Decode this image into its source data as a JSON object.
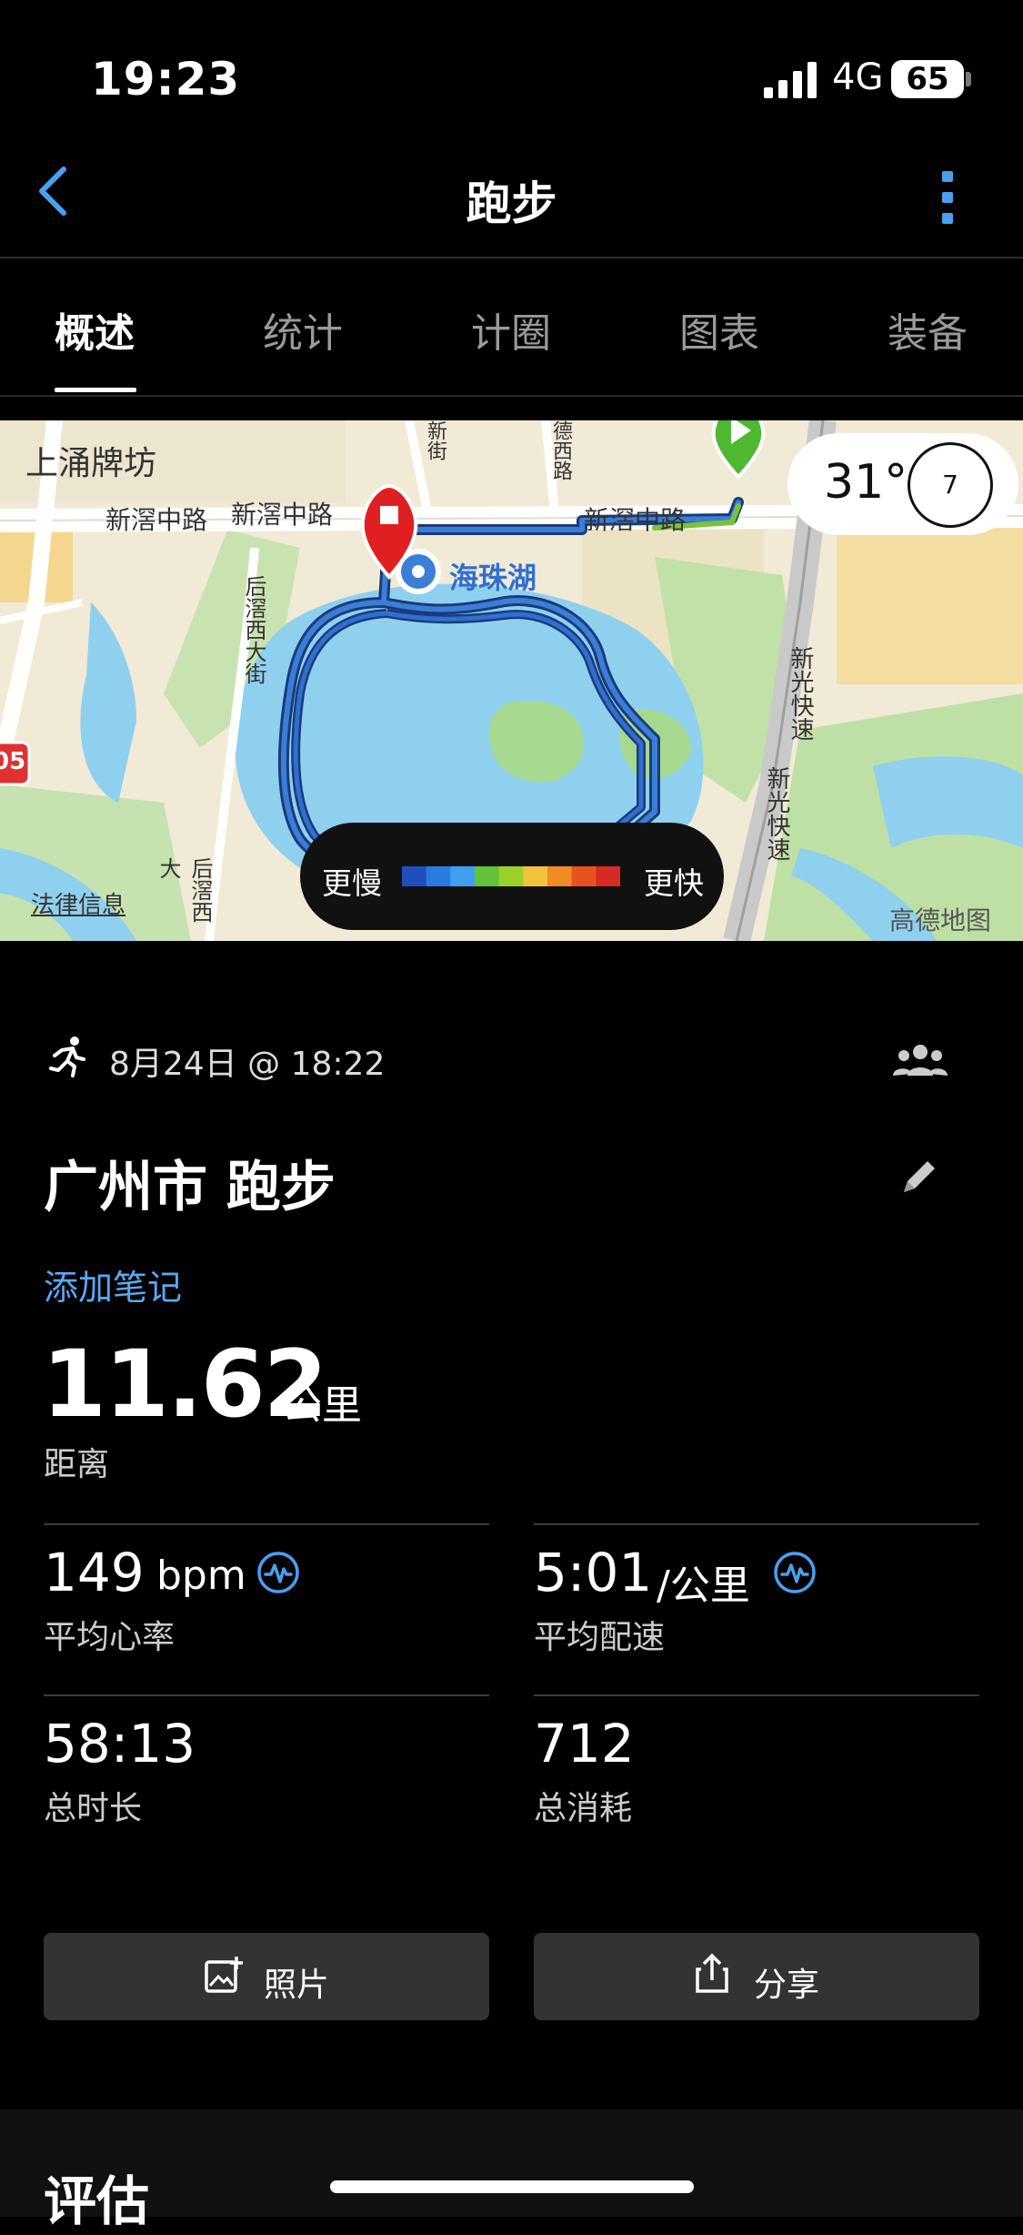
{
  "status_bar": {
    "time": "19:23",
    "network": "4G",
    "battery": "65"
  },
  "nav": {
    "title": "跑步"
  },
  "tabs": [
    {
      "label": "概述",
      "active": true
    },
    {
      "label": "统计",
      "active": false
    },
    {
      "label": "计圈",
      "active": false
    },
    {
      "label": "图表",
      "active": false
    },
    {
      "label": "装备",
      "active": false
    }
  ],
  "map": {
    "labels": {
      "shangyong": "上涌牌坊",
      "road1": "新滘中路",
      "road2": "新滘中路",
      "road3": "新滘中路",
      "lake": "海珠湖",
      "houjiao": "后滘西大街",
      "houjiao2": "后滘西大",
      "xinguang1": "新光快速",
      "xinguang2": "新光快速",
      "legal": "法律信息",
      "provider": "高德地图",
      "badge": "05",
      "jie": "新街",
      "xilu": "德西路"
    },
    "legend": {
      "slow": "更慢",
      "fast": "更快",
      "colors": [
        "#1f4fbf",
        "#2a7be0",
        "#3fa0f0",
        "#62c23a",
        "#9bd02a",
        "#f2c23a",
        "#f08a24",
        "#e8521f",
        "#d82a22"
      ]
    },
    "weather": {
      "temp": "31°",
      "wind": "7"
    }
  },
  "activity": {
    "date": "8月24日 @ 18:22",
    "title": "广州市 跑步",
    "add_note": "添加笔记",
    "distance": {
      "value": "11.62",
      "unit": "公里",
      "label": "距离"
    },
    "stats": [
      {
        "value": "149",
        "unit": "bpm",
        "label": "平均心率"
      },
      {
        "value": "5:01",
        "unit": "/公里",
        "label": "平均配速"
      },
      {
        "value": "58:13",
        "unit": "",
        "label": "总时长"
      },
      {
        "value": "712",
        "unit": "",
        "label": "总消耗"
      }
    ]
  },
  "buttons": {
    "photo": "照片",
    "share": "分享"
  },
  "section": {
    "evaluation": "评估"
  },
  "colors": {
    "accent": "#59a8f2",
    "start": "#4db830",
    "end": "#e02020"
  }
}
